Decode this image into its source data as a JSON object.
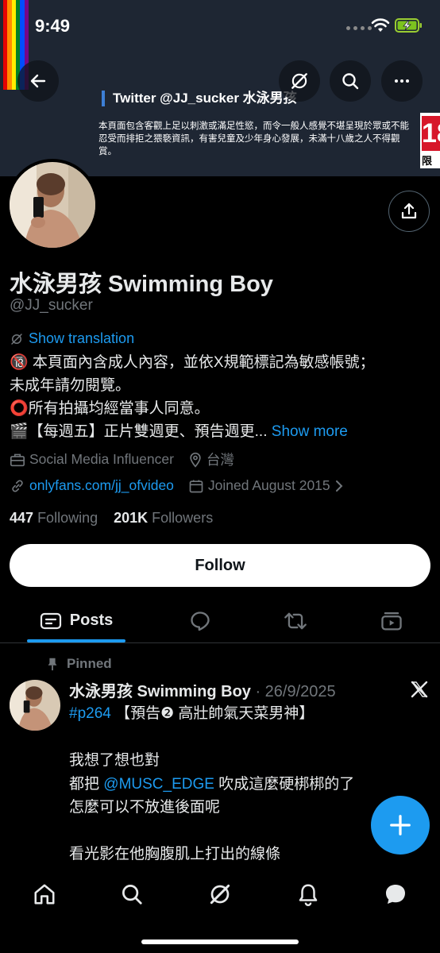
{
  "status_bar": {
    "time": "9:49"
  },
  "colors": {
    "accent": "#1d9bf0",
    "background": "#000000",
    "banner": "#1e2633",
    "rating_red": "#d7172a"
  },
  "banner": {
    "title": "Twitter @JJ_sucker 水泳男孩",
    "warning": "本頁面包含客觀上足以刺激或滿足性慾，而令一般人感覺不堪呈現於眾或不能忍受而排拒之猥褻資訊，有害兒童及少年身心發展，未滿十八歲之人不得觀賞。",
    "rating_number": "18",
    "rating_label": "限"
  },
  "header_buttons": [
    "back-arrow-icon",
    "grok-icon",
    "search-icon",
    "more-icon"
  ],
  "profile": {
    "display_name": "水泳男孩 Swimming Boy",
    "handle": "@JJ_sucker",
    "translate_label": "Show translation",
    "bio_line_1": "🔞 本頁面內含成人內容，並依X規範標記為敏感帳號；",
    "bio_line_2": "未成年請勿閱覽。",
    "bio_line_3": "⭕️所有拍攝均經當事人同意。",
    "bio_line_4": "🎬【每週五】正片雙週更、預告週更...",
    "show_more": "Show more",
    "category": "Social Media Influencer",
    "location": "台灣",
    "website": "onlyfans.com/jj_ofvideo",
    "joined": "Joined August 2015",
    "following_count": "447",
    "following_label": "Following",
    "followers_count": "201K",
    "followers_label": "Followers",
    "follow_button": "Follow"
  },
  "tabs": {
    "posts_label": "Posts"
  },
  "pinned_post": {
    "pinned_label": "Pinned",
    "author": "水泳男孩 Swimming Boy",
    "date": "· 26/9/2025",
    "hashtag": "#p264",
    "line_1_rest": " 【預告❷ 高壯帥氣天菜男神】",
    "line_2": "我想了想也對",
    "line_3_pre": "都把 ",
    "mention": "@MUSC_EDGE",
    "line_3_post": " 吹成這麼硬梆梆的了",
    "line_4": "怎麼可以不放進後面呢",
    "line_5": "看光影在他胸腹肌上打出的線條"
  },
  "bottom_nav": [
    "home-icon",
    "explore-icon",
    "grok-icon",
    "notifications-icon",
    "messages-icon"
  ]
}
